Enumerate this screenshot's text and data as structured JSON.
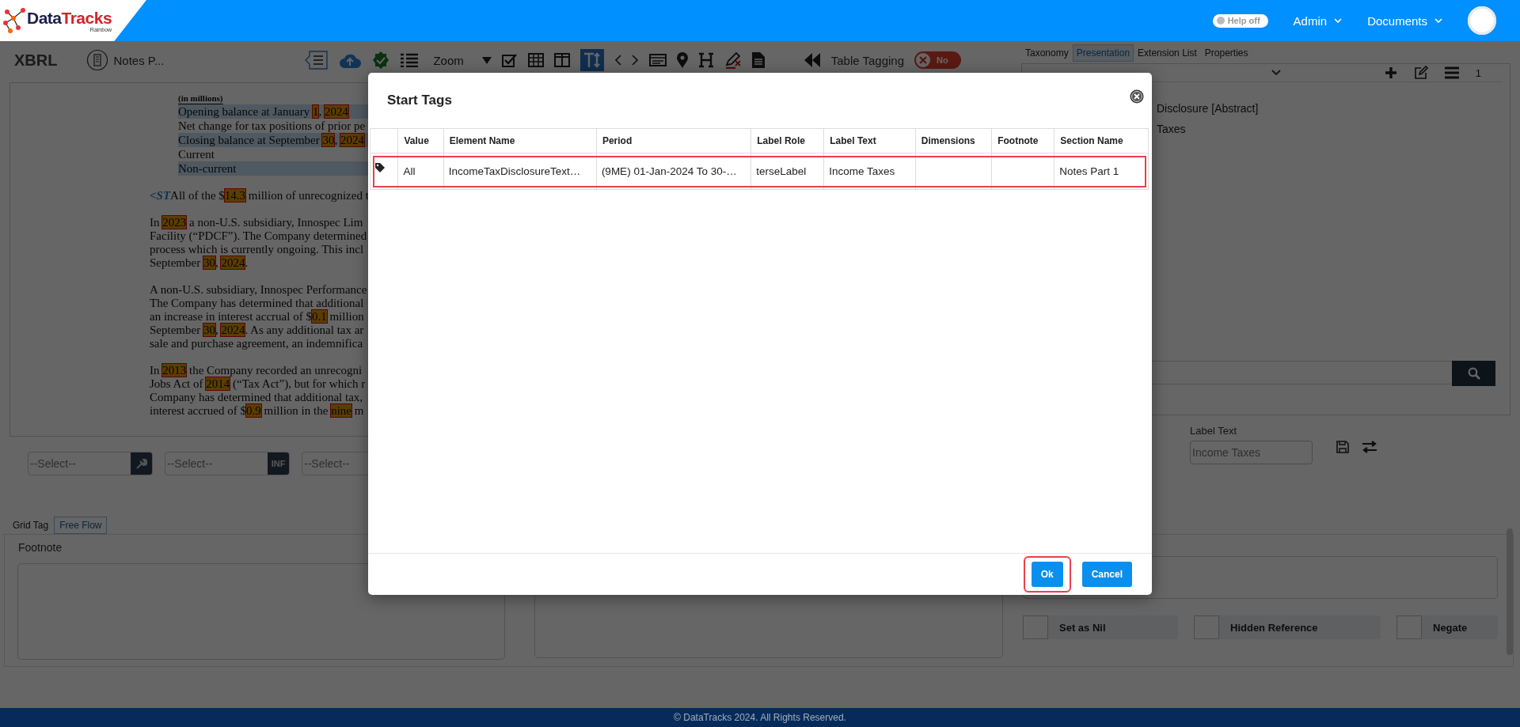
{
  "header": {
    "logo": {
      "text_1": "Data",
      "text_2": "Tracks",
      "tagline": "Rainbow"
    },
    "help_toggle": {
      "label": "Help off",
      "on": false
    },
    "menus": [
      {
        "label": "Admin"
      },
      {
        "label": "Documents"
      }
    ]
  },
  "toolbar": {
    "title": "XBRL",
    "document": "Notes P...",
    "zoom_label": "Zoom",
    "table_tagging": {
      "label": "Table Tagging",
      "toggle_label": "No",
      "on": false
    }
  },
  "document": {
    "table_heading": "(in millions)",
    "table_rows": [
      {
        "shaded": true,
        "segments": [
          {
            "kind": "text",
            "text": "Opening balance at January "
          },
          {
            "kind": "tag",
            "text": "1"
          },
          {
            "kind": "text",
            "text": ", "
          },
          {
            "kind": "tag",
            "text": "2024"
          }
        ]
      },
      {
        "shaded": false,
        "segments": [
          {
            "kind": "text",
            "text": "Net change for tax positions of prior pe"
          }
        ]
      },
      {
        "shaded": true,
        "segments": [
          {
            "kind": "text",
            "text": "Closing balance at September "
          },
          {
            "kind": "tag",
            "text": "30"
          },
          {
            "kind": "text",
            "text": ", "
          },
          {
            "kind": "tag",
            "text": "2024"
          }
        ]
      },
      {
        "shaded": false,
        "segments": [
          {
            "kind": "text",
            "text": "Current"
          }
        ]
      },
      {
        "shaded": true,
        "segments": [
          {
            "kind": "text",
            "text": "Non-current"
          }
        ]
      }
    ],
    "paragraphs": [
      {
        "lines": [
          [
            {
              "kind": "marker",
              "text": "<ST"
            },
            {
              "kind": "text",
              "text": "All of the $"
            },
            {
              "kind": "tag",
              "text": "14.3"
            },
            {
              "kind": "text",
              "text": " million of unrecognized t"
            }
          ]
        ]
      },
      {
        "lines": [
          [
            {
              "kind": "text",
              "text": "In "
            },
            {
              "kind": "tag",
              "text": "2023"
            },
            {
              "kind": "text",
              "text": " a non-U.S. subsidiary, Innospec Lim"
            }
          ],
          [
            {
              "kind": "text",
              "text": "Facility (“PDCF”). The Company determined"
            }
          ],
          [
            {
              "kind": "text",
              "text": "process which is currently ongoing. This incl"
            }
          ],
          [
            {
              "kind": "text",
              "text": "September "
            },
            {
              "kind": "tag",
              "text": "30"
            },
            {
              "kind": "text",
              "text": ", "
            },
            {
              "kind": "tag",
              "text": "2024"
            },
            {
              "kind": "text",
              "text": "."
            }
          ]
        ]
      },
      {
        "lines": [
          [
            {
              "kind": "text",
              "text": "A non-U.S. subsidiary, Innospec Performance"
            }
          ],
          [
            {
              "kind": "text",
              "text": "The Company has determined that additional"
            }
          ],
          [
            {
              "kind": "text",
              "text": "an increase in interest accrual of $"
            },
            {
              "kind": "tag",
              "text": "0.1"
            },
            {
              "kind": "text",
              "text": " million"
            }
          ],
          [
            {
              "kind": "text",
              "text": "September "
            },
            {
              "kind": "tag",
              "text": "30"
            },
            {
              "kind": "text",
              "text": ", "
            },
            {
              "kind": "tag",
              "text": "2024"
            },
            {
              "kind": "text",
              "text": ". As any additional tax ar"
            }
          ],
          [
            {
              "kind": "text",
              "text": "sale and purchase agreement, an indemnifica"
            }
          ]
        ]
      },
      {
        "lines": [
          [
            {
              "kind": "text",
              "text": "In "
            },
            {
              "kind": "tag",
              "text": "2013"
            },
            {
              "kind": "text",
              "text": " the Company recorded an unrecogni"
            }
          ],
          [
            {
              "kind": "text",
              "text": "Jobs Act of "
            },
            {
              "kind": "tag",
              "text": "2014"
            },
            {
              "kind": "text",
              "text": " (“Tax Act”), but for which r"
            }
          ],
          [
            {
              "kind": "text",
              "text": "Company has determined that additional tax,"
            }
          ],
          [
            {
              "kind": "text",
              "text": "interest accrued of $"
            },
            {
              "kind": "tag",
              "text": "0.9"
            },
            {
              "kind": "text",
              "text": " million in the "
            },
            {
              "kind": "tag",
              "text": "nine"
            },
            {
              "kind": "text",
              "text": " m"
            }
          ]
        ]
      }
    ]
  },
  "selects": [
    {
      "value": "--Select--",
      "kind": "wrench"
    },
    {
      "value": "--Select--",
      "kind": "text",
      "addon_text": "INF"
    },
    {
      "value": "--Select--",
      "kind": "plain"
    }
  ],
  "right_tabs": [
    {
      "label": "Taxonomy",
      "selected": false
    },
    {
      "label": "Presentation",
      "selected": true
    },
    {
      "label": "Extension List",
      "selected": false
    },
    {
      "label": "Properties",
      "selected": false
    }
  ],
  "tree_panel": {
    "count": "1",
    "items": [
      {
        "label": "Disclosure [Abstract]"
      },
      {
        "label": "Taxes"
      }
    ]
  },
  "label_text": {
    "label": "Label Text",
    "value": "Income Taxes"
  },
  "bottom_tabs": [
    {
      "label": "Grid Tag",
      "selected": false
    },
    {
      "label": "Free Flow",
      "selected": true
    }
  ],
  "footnote": {
    "label": "Footnote"
  },
  "flags": [
    {
      "label": "Set as Nil",
      "checked": false
    },
    {
      "label": "Hidden Reference",
      "checked": false
    },
    {
      "label": "Negate",
      "checked": false
    }
  ],
  "footer": "© DataTracks 2024. All Rights Reserved.",
  "modal": {
    "title": "Start Tags",
    "columns": [
      "Value",
      "Element Name",
      "Period",
      "Label Role",
      "Label Text",
      "Dimensions",
      "Footnote",
      "Section Name"
    ],
    "rows": [
      {
        "selected": true,
        "cells": [
          "All",
          "IncomeTaxDisclosureText…",
          "(9ME) 01-Jan-2024 To 30-…",
          "terseLabel",
          "Income Taxes",
          null,
          null,
          "Notes Part 1"
        ]
      }
    ],
    "buttons": [
      {
        "label": "Ok",
        "highlighted": true
      },
      {
        "label": "Cancel",
        "highlighted": false
      }
    ]
  }
}
